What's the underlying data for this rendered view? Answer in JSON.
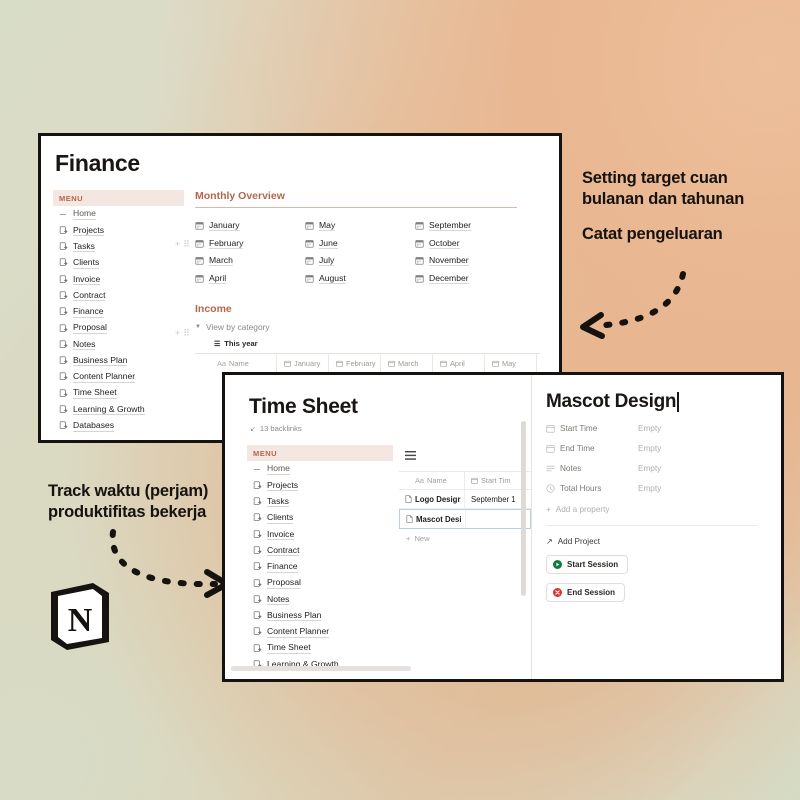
{
  "annotations": {
    "right_line1": "Setting target cuan",
    "right_line2": "bulanan dan tahunan",
    "right_line3": "Catat pengeluaran",
    "left_line1": "Track waktu (perjam)",
    "left_line2": "produktifitas bekerja",
    "logo_letter": "N",
    "logo_name": "notion-logo"
  },
  "finance_window": {
    "title": "Finance",
    "menu_header": "MENU",
    "menu_items": [
      {
        "label": "Home",
        "icon": "arrow-left-icon"
      },
      {
        "label": "Projects",
        "icon": "page-icon"
      },
      {
        "label": "Tasks",
        "icon": "page-icon"
      },
      {
        "label": "Clients",
        "icon": "page-icon"
      },
      {
        "label": "Invoice",
        "icon": "page-icon"
      },
      {
        "label": "Contract",
        "icon": "page-icon"
      },
      {
        "label": "Finance",
        "icon": "page-icon"
      },
      {
        "label": "Proposal",
        "icon": "page-icon"
      },
      {
        "label": "Notes",
        "icon": "page-icon"
      },
      {
        "label": "Business Plan",
        "icon": "page-icon"
      },
      {
        "label": "Content Planner",
        "icon": "page-icon"
      },
      {
        "label": "Time Sheet",
        "icon": "page-icon"
      },
      {
        "label": "Learning & Growth",
        "icon": "page-icon"
      },
      {
        "label": "Databases",
        "icon": "page-icon"
      }
    ],
    "monthly_overview_heading": "Monthly Overview",
    "months_col1": [
      "January",
      "February",
      "March",
      "April"
    ],
    "months_col2": [
      "May",
      "June",
      "July",
      "August"
    ],
    "months_col3": [
      "September",
      "October",
      "November",
      "December"
    ],
    "income_heading": "Income",
    "view_by_category": "View by category",
    "this_year": "This year",
    "table_columns": [
      "Aa Name",
      "January",
      "February",
      "March",
      "April",
      "May"
    ]
  },
  "timesheet_window": {
    "title": "Time Sheet",
    "backlinks": "13 backlinks",
    "menu_header": "MENU",
    "menu_items": [
      {
        "label": "Home",
        "icon": "arrow-left-icon"
      },
      {
        "label": "Projects",
        "icon": "page-icon"
      },
      {
        "label": "Tasks",
        "icon": "page-icon"
      },
      {
        "label": "Clients",
        "icon": "page-icon"
      },
      {
        "label": "Invoice",
        "icon": "page-icon"
      },
      {
        "label": "Contract",
        "icon": "page-icon"
      },
      {
        "label": "Finance",
        "icon": "page-icon"
      },
      {
        "label": "Proposal",
        "icon": "page-icon"
      },
      {
        "label": "Notes",
        "icon": "page-icon"
      },
      {
        "label": "Business Plan",
        "icon": "page-icon"
      },
      {
        "label": "Content Planner",
        "icon": "page-icon"
      },
      {
        "label": "Time Sheet",
        "icon": "page-icon"
      },
      {
        "label": "Learning & Growth",
        "icon": "page-icon"
      }
    ],
    "table": {
      "columns": [
        "Aa Name",
        "Start Tim"
      ],
      "rows": [
        {
          "name": "Logo Desigr",
          "start_time": "September 1"
        },
        {
          "name": "Mascot Desi",
          "start_time": ""
        }
      ],
      "new_row_label": "New"
    },
    "detail": {
      "title": "Mascot Design",
      "properties": [
        {
          "label": "Start Time",
          "value": "Empty",
          "icon": "calendar-icon"
        },
        {
          "label": "End Time",
          "value": "Empty",
          "icon": "calendar-icon"
        },
        {
          "label": "Notes",
          "value": "Empty",
          "icon": "text-lines-icon"
        },
        {
          "label": "Total Hours",
          "value": "Empty",
          "icon": "clock-icon"
        }
      ],
      "add_property_label": "Add a property",
      "add_project_label": "Add Project",
      "start_session_label": "Start Session",
      "end_session_label": "End Session",
      "start_color": "#0f7b3f",
      "end_color": "#d9342b"
    }
  }
}
